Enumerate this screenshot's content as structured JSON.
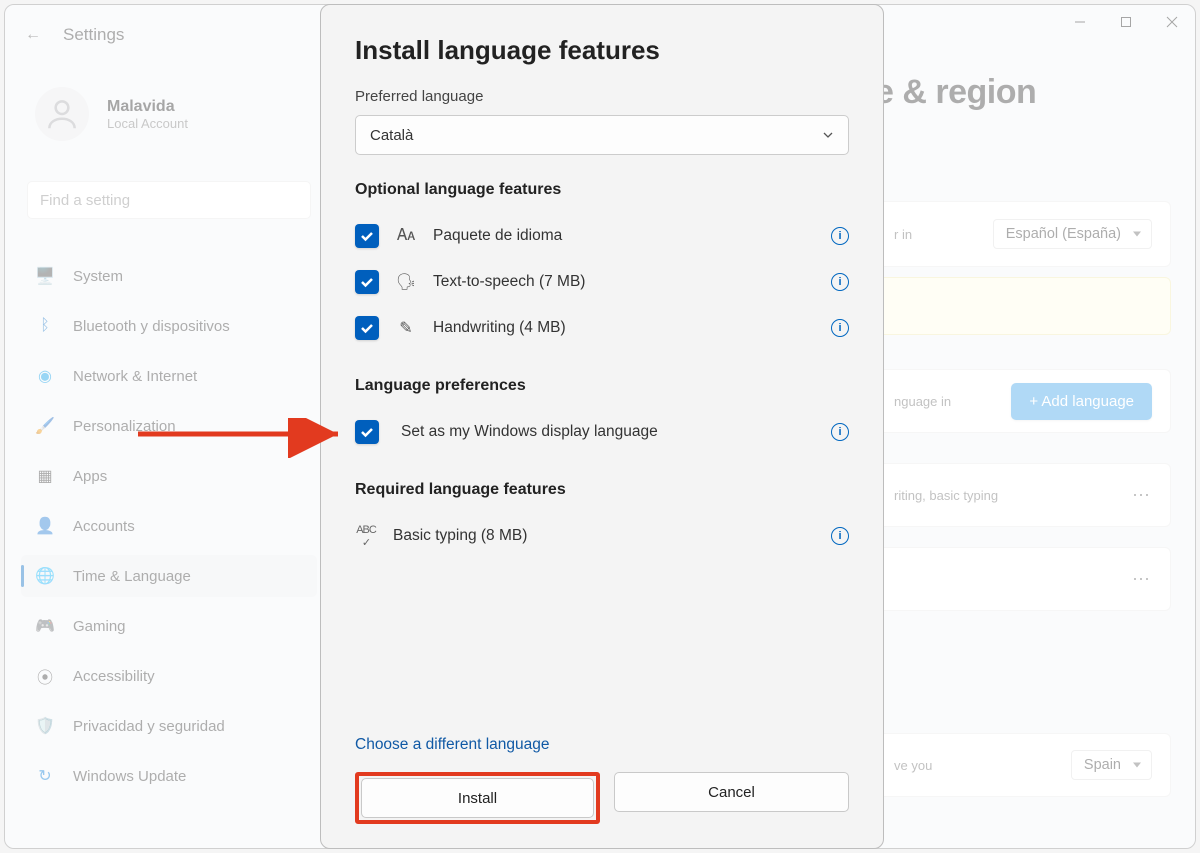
{
  "app": {
    "title": "Settings"
  },
  "user": {
    "name": "Malavida",
    "subtitle": "Local Account"
  },
  "search": {
    "placeholder": "Find a setting"
  },
  "nav": {
    "items": [
      {
        "label": "System"
      },
      {
        "label": "Bluetooth y dispositivos"
      },
      {
        "label": "Network & Internet"
      },
      {
        "label": "Personalization"
      },
      {
        "label": "Apps"
      },
      {
        "label": "Accounts"
      },
      {
        "label": "Time & Language"
      },
      {
        "label": "Gaming"
      },
      {
        "label": "Accessibility"
      },
      {
        "label": "Privacidad y seguridad"
      },
      {
        "label": "Windows Update"
      }
    ]
  },
  "page": {
    "heading_partial": "e & region",
    "windows_display_in": "r in",
    "windows_display_value": "Español (España)",
    "preferred_fragment": "nguage in",
    "add_language_label": "+ Add language",
    "row1_fragment": "riting, basic typing",
    "country_fragment": "ve you",
    "country_value": "Spain"
  },
  "dialog": {
    "title": "Install language features",
    "preferred_label": "Preferred language",
    "preferred_value": "Català",
    "optional_header": "Optional language features",
    "features": [
      {
        "label": "Paquete de idioma"
      },
      {
        "label": "Text-to-speech (7 MB)"
      },
      {
        "label": "Handwriting (4 MB)"
      }
    ],
    "prefs_header": "Language preferences",
    "set_display_label": "Set as my Windows display language",
    "required_header": "Required language features",
    "basic_typing_label": "Basic typing (8 MB)",
    "choose_different": "Choose a different language",
    "install_btn": "Install",
    "cancel_btn": "Cancel"
  }
}
